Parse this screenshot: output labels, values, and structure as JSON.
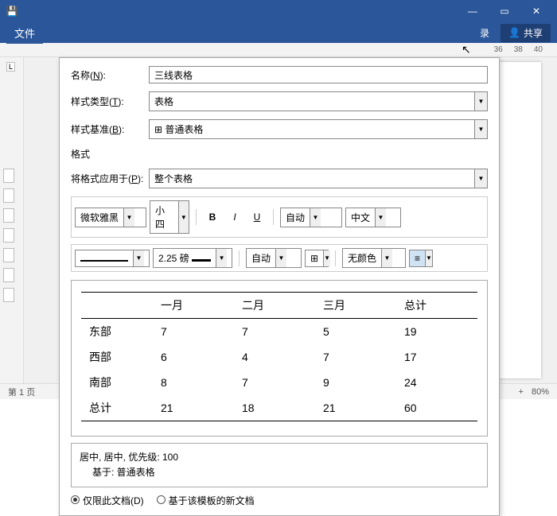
{
  "titlebar": {
    "save_icon": "💾"
  },
  "ribbon": {
    "file": "文件",
    "login": "录",
    "share": "共享",
    "share_icon": "👤"
  },
  "ruler": {
    "n36": "36",
    "n38": "38",
    "n40": "40"
  },
  "lgutter": {
    "L": "L"
  },
  "dialog": {
    "name_lbl_pre": "名称(",
    "name_lbl_u": "N",
    "name_lbl_post": "):",
    "name_val": "三线表格",
    "styletype_lbl_pre": "样式类型(",
    "styletype_lbl_u": "T",
    "styletype_lbl_post": "):",
    "styletype_val": "表格",
    "baseon_lbl_pre": "样式基准(",
    "baseon_lbl_u": "B",
    "baseon_lbl_post": "):",
    "baseon_icon": "⊞",
    "baseon_val": "普通表格",
    "format_section": "格式",
    "applyto_lbl_pre": "将格式应用于(",
    "applyto_lbl_u": "P",
    "applyto_lbl_post": "):",
    "applyto_val": "整个表格",
    "font_name": "微软雅黑",
    "font_size": "小四",
    "color_auto": "自动",
    "lang": "中文",
    "line_weight": "2.25 磅",
    "line_color": "自动",
    "shading": "无颜色",
    "desc_line1": "居中, 居中, 优先级: 100",
    "desc_line2": "基于: 普通表格",
    "radio_thisdoc_pre": "仅限此文档(",
    "radio_thisdoc_u": "D",
    "radio_thisdoc_post": ")",
    "radio_template": "基于该模板的新文档"
  },
  "chart_data": {
    "type": "table",
    "title": "",
    "columns": [
      "",
      "一月",
      "二月",
      "三月",
      "总计"
    ],
    "rows": [
      {
        "label": "东部",
        "values": [
          7,
          7,
          5,
          19
        ]
      },
      {
        "label": "西部",
        "values": [
          6,
          4,
          7,
          17
        ]
      },
      {
        "label": "南部",
        "values": [
          8,
          7,
          9,
          24
        ]
      },
      {
        "label": "总计",
        "values": [
          21,
          18,
          21,
          60
        ]
      }
    ]
  },
  "status": {
    "page": "第 1 页",
    "plus": "+",
    "zoom": "80%"
  }
}
